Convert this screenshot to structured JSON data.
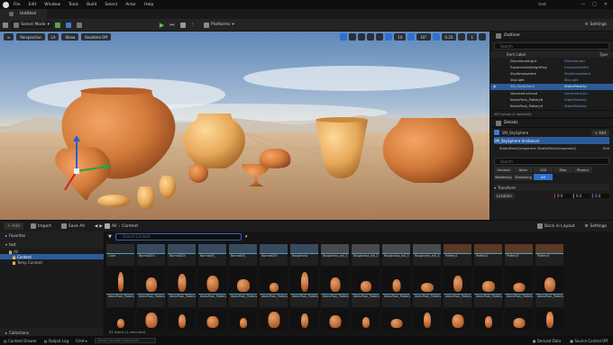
{
  "menu": [
    "File",
    "Edit",
    "Window",
    "Tools",
    "Build",
    "Select",
    "Actor",
    "Help"
  ],
  "project_name": "test",
  "window_controls": [
    "—",
    "□",
    "✕"
  ],
  "tab": {
    "label": "Untitled"
  },
  "toolbar": {
    "mode": "Select Mode",
    "platforms": "Platforms",
    "settings": "Settings"
  },
  "viewport": {
    "perspective": "Perspective",
    "lit": "Lit",
    "show": "Show",
    "realtime": "Realtime Off",
    "snap_values": [
      "10",
      "10°",
      "0.25"
    ],
    "camera_speed": "1"
  },
  "outliner": {
    "title": "Outliner",
    "search_placeholder": "Search",
    "col_item": "Item Label",
    "col_type": "Type",
    "rows": [
      {
        "name": "DirectionalLight",
        "type": "DirectionalLi"
      },
      {
        "name": "ExponentialHeightFog",
        "type": "ExponentialHe"
      },
      {
        "name": "SkyAtmosphere",
        "type": "SkyAtmosphere"
      },
      {
        "name": "SkyLight",
        "type": "SkyLight"
      },
      {
        "name": "SM_SkySphere",
        "type": "StaticMeshAc"
      },
      {
        "name": "VolumetricCloud",
        "type": "VolumetricClo"
      },
      {
        "name": "ItemsPack_Pottery6",
        "type": "StaticMeshAc"
      },
      {
        "name": "ItemsPack_Pottery9",
        "type": "StaticMeshAc"
      }
    ],
    "count": "597 actors (1 selected)"
  },
  "details": {
    "title": "Details",
    "object": "SM_SkySphere",
    "add_label": "+ Add",
    "instance": "SM_SkySphere (Instance)",
    "component": "StaticMeshComponent (StaticMeshComponent)",
    "edit_label": "Edit",
    "search_placeholder": "Search",
    "categories": [
      "General",
      "Actor",
      "LOD",
      "Misc",
      "Physics",
      "Rendering",
      "Streaming",
      "All"
    ],
    "transform_label": "Transform",
    "location_label": "Location",
    "location_values": [
      "0.0",
      "0.0",
      "0.0"
    ]
  },
  "content_browser": {
    "add": "+ Add",
    "import": "Import",
    "save_all": "Save All",
    "path": [
      "All",
      "Content"
    ],
    "dock": "Dock in Layout",
    "settings": "Settings",
    "favorites": "Favorites",
    "project": "test",
    "tree": [
      "All",
      "Content",
      "Temp Content"
    ],
    "collections": "Collections",
    "search_placeholder": "Search Content",
    "count": "61 items (1 selected)",
    "row1": [
      "Cube",
      "Normal01h",
      "Normal02h",
      "Normal03_",
      "Normal03_",
      "Normal03h",
      "Roughness",
      "Roughness_roll_1",
      "Roughness_roll_2",
      "Roughness_roll_3",
      "Roughness_roll_4",
      "Pottery1",
      "Pottery2",
      "Pottery3",
      "Pottery4"
    ],
    "row2": [
      "ItemsPack_Pottery1",
      "ItemsPack_Pottery2",
      "ItemsPack_Pottery3",
      "ItemsPack_Pottery4",
      "ItemsPack_Pottery5",
      "ItemsPack_Pottery6",
      "ItemsPack_Pottery7",
      "ItemsPack_Pottery8",
      "ItemsPack_Pottery9",
      "ItemsPack_Pottery10",
      "ItemsPack_Pottery11",
      "ItemsPack_Pottery12",
      "ItemsPack_Pottery13",
      "ItemsPack_Pottery14",
      "ItemsPack_Pottery15"
    ]
  },
  "statusbar": {
    "content_drawer": "Content Drawer",
    "output_log": "Output Log",
    "cmd": "Cmd",
    "cmd_placeholder": "Enter Console Command",
    "derived_data": "Derived Data",
    "source_control": "Source Control Off"
  },
  "colors": {
    "accent": "#2f6fd0",
    "selected": "#2d5b9a",
    "pottery": "#d1783a"
  }
}
